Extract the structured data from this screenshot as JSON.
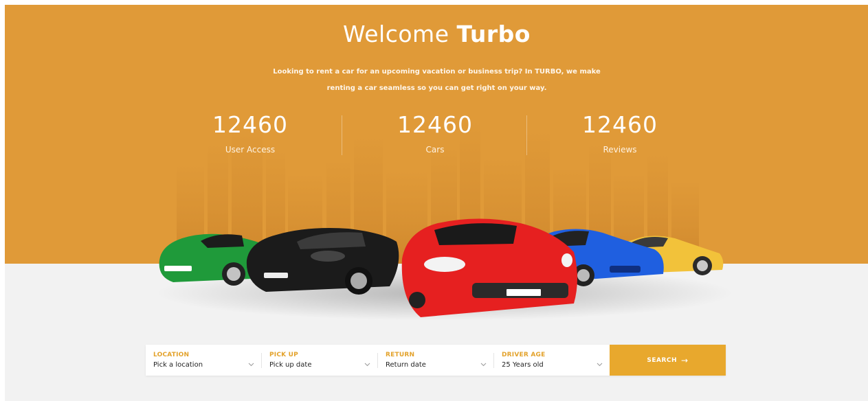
{
  "hero": {
    "title_light": "Welcome",
    "title_bold": "Turbo",
    "intro_line1": "Looking to rent a car for an upcoming vacation or business trip? In TURBO, we make",
    "intro_line2": "renting a car seamless so you can get right on your way.",
    "stats": [
      {
        "value": "12460",
        "label": "User Access"
      },
      {
        "value": "12460",
        "label": "Cars"
      },
      {
        "value": "12460",
        "label": "Reviews"
      }
    ],
    "background_color": "#e09a38"
  },
  "cars": [
    "green-car",
    "black-car",
    "red-car",
    "blue-car",
    "yellow-car"
  ],
  "search": {
    "fields": [
      {
        "label": "LOCATION",
        "value": "Pick a location"
      },
      {
        "label": "PICK UP",
        "value": "Pick up date"
      },
      {
        "label": "RETURN",
        "value": "Return date"
      },
      {
        "label": "DRIVER AGE",
        "value": "25 Years old"
      }
    ],
    "button_label": "SEARCH",
    "button_icon": "arrow-right-icon",
    "accent_color": "#e8a82d"
  }
}
